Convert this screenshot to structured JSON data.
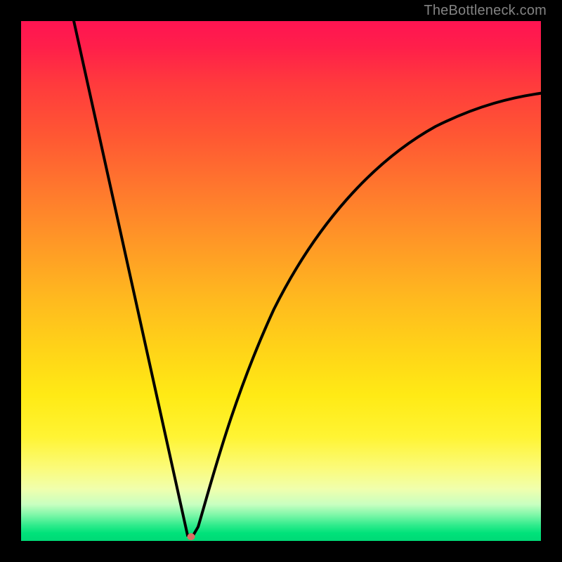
{
  "watermark": "TheBottleneck.com",
  "colors": {
    "background": "#000000",
    "curve_stroke": "#000000",
    "marker": "#dc6f64",
    "gradient_top": "#ff1452",
    "gradient_bottom": "#00d976"
  },
  "chart_data": {
    "type": "line",
    "title": "",
    "xlabel": "",
    "ylabel": "",
    "xlim": [
      0,
      100
    ],
    "ylim": [
      0,
      100
    ],
    "annotations": [],
    "marker_point": {
      "x": 32.5,
      "y": 0.5
    },
    "series": [
      {
        "name": "left-branch",
        "description": "steep descending line from top to minimum",
        "points": [
          {
            "x": 10,
            "y": 100
          },
          {
            "x": 32,
            "y": 1
          }
        ]
      },
      {
        "name": "right-branch",
        "description": "ascending decelerating curve from minimum toward upper right",
        "points": [
          {
            "x": 33,
            "y": 1
          },
          {
            "x": 35,
            "y": 11
          },
          {
            "x": 38,
            "y": 24
          },
          {
            "x": 42,
            "y": 38
          },
          {
            "x": 47,
            "y": 50
          },
          {
            "x": 53,
            "y": 60
          },
          {
            "x": 60,
            "y": 68
          },
          {
            "x": 68,
            "y": 74
          },
          {
            "x": 77,
            "y": 79
          },
          {
            "x": 86,
            "y": 82.5
          },
          {
            "x": 95,
            "y": 85
          },
          {
            "x": 100,
            "y": 86
          }
        ]
      }
    ]
  }
}
